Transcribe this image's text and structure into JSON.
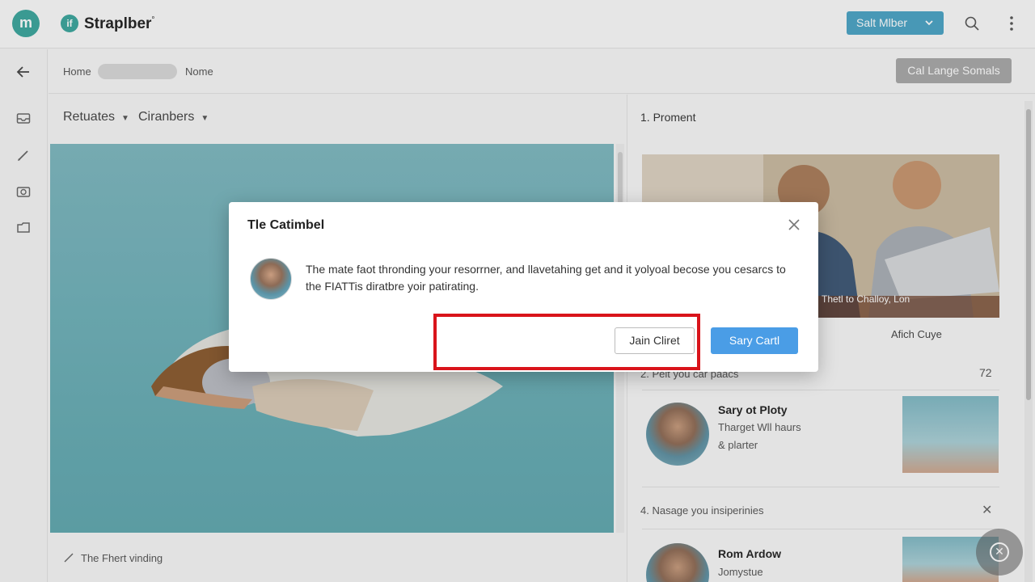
{
  "app": {
    "logo_letter": "m",
    "brand_icon_letter": "if",
    "brand_name": "Straplber",
    "brand_mark": "°",
    "top_action_label": "Salt Mlber",
    "top_action_icon": "chevron-down-icon",
    "search_icon": "search-icon",
    "more_icon": "more-vertical-icon"
  },
  "rail": {
    "back_icon": "back-arrow-icon",
    "items": [
      "inbox-icon",
      "pen-icon",
      "camera-icon",
      "folder-icon"
    ]
  },
  "breadcrumb": {
    "first": "Home",
    "last": "Nome",
    "right_button": "Cal Lange Somals"
  },
  "main": {
    "filters": [
      {
        "label": "Retuates"
      },
      {
        "label": "Ciranbers"
      }
    ],
    "caption": "The Fhert vinding"
  },
  "panel": {
    "section1_title": "1. Proment",
    "photo_caption": "Thetl to Challoy, Lon",
    "photo_sub": "Afich Cuye",
    "section2_title": "2. Pelt you car paacs",
    "section2_count": "72",
    "card1": {
      "name": "Sary ot Ploty",
      "line1": "Tharget Wll haurs",
      "line2": "& plarter"
    },
    "section4_title": "4. Nasage you insiperinies",
    "card2": {
      "name": "Rom Ardow",
      "line1": "Jomystue"
    }
  },
  "modal": {
    "title": "Tle Catimbel",
    "text": "The mate faot thronding your resorrner, and llavetahing get and it yolyoal becose you cesarcs to the FIATTis diratbre yoir patirating.",
    "secondary_button": "Jain Cliret",
    "primary_button": "Sary Cartl",
    "highlight_color": "#d9141b"
  }
}
